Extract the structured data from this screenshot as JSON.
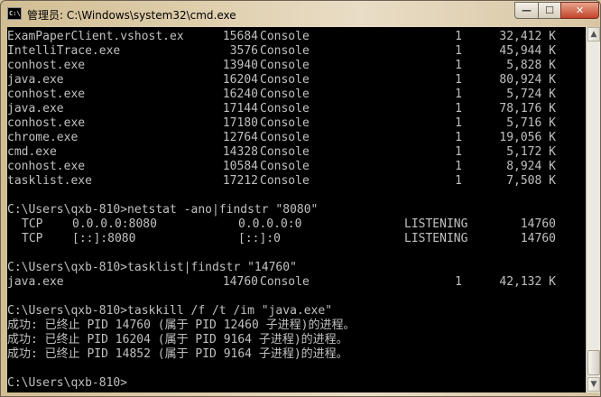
{
  "window": {
    "icon_glyph": "C:\\",
    "title": "管理员: C:\\Windows\\system32\\cmd.exe",
    "minimize_glyph": "—",
    "maximize_glyph": "☐",
    "close_glyph": "✕"
  },
  "console": {
    "tasklist_rows": [
      {
        "name": "ExamPaperClient.vshost.ex",
        "pid": "15684",
        "session": "Console",
        "num": "1",
        "mem": "32,412 K"
      },
      {
        "name": "IntelliTrace.exe",
        "pid": "3576",
        "session": "Console",
        "num": "1",
        "mem": "45,944 K"
      },
      {
        "name": "conhost.exe",
        "pid": "13940",
        "session": "Console",
        "num": "1",
        "mem": "5,828 K"
      },
      {
        "name": "java.exe",
        "pid": "16204",
        "session": "Console",
        "num": "1",
        "mem": "80,924 K"
      },
      {
        "name": "conhost.exe",
        "pid": "16240",
        "session": "Console",
        "num": "1",
        "mem": "5,724 K"
      },
      {
        "name": "java.exe",
        "pid": "17144",
        "session": "Console",
        "num": "1",
        "mem": "78,176 K"
      },
      {
        "name": "conhost.exe",
        "pid": "17180",
        "session": "Console",
        "num": "1",
        "mem": "5,716 K"
      },
      {
        "name": "chrome.exe",
        "pid": "12764",
        "session": "Console",
        "num": "1",
        "mem": "19,056 K"
      },
      {
        "name": "cmd.exe",
        "pid": "14328",
        "session": "Console",
        "num": "1",
        "mem": "5,172 K"
      },
      {
        "name": "conhost.exe",
        "pid": "10584",
        "session": "Console",
        "num": "1",
        "mem": "8,924 K"
      },
      {
        "name": "tasklist.exe",
        "pid": "17212",
        "session": "Console",
        "num": "1",
        "mem": "7,508 K"
      }
    ],
    "cmd_netstat": "C:\\Users\\qxb-810>netstat -ano|findstr \"8080\"",
    "netstat_rows": [
      {
        "proto": "TCP",
        "local": "0.0.0.0:8080",
        "foreign": "0.0.0.0:0",
        "state": "LISTENING",
        "pid": "14760"
      },
      {
        "proto": "TCP",
        "local": "[::]:8080",
        "foreign": "[::]:0",
        "state": "LISTENING",
        "pid": "14760"
      }
    ],
    "cmd_tasklist": "C:\\Users\\qxb-810>tasklist|findstr \"14760\"",
    "tasklist_result": {
      "name": "java.exe",
      "pid": "14760",
      "session": "Console",
      "num": "1",
      "mem": "42,132 K"
    },
    "cmd_taskkill": "C:\\Users\\qxb-810>taskkill /f /t /im \"java.exe\"",
    "taskkill_output": [
      "成功: 已终止 PID 14760 (属于 PID 12460 子进程)的进程。",
      "成功: 已终止 PID 16204 (属于 PID 9164 子进程)的进程。",
      "成功: 已终止 PID 14852 (属于 PID 9164 子进程)的进程。"
    ],
    "prompt": "C:\\Users\\qxb-810>"
  },
  "scrollbar": {
    "up_glyph": "▲",
    "down_glyph": "▼"
  }
}
